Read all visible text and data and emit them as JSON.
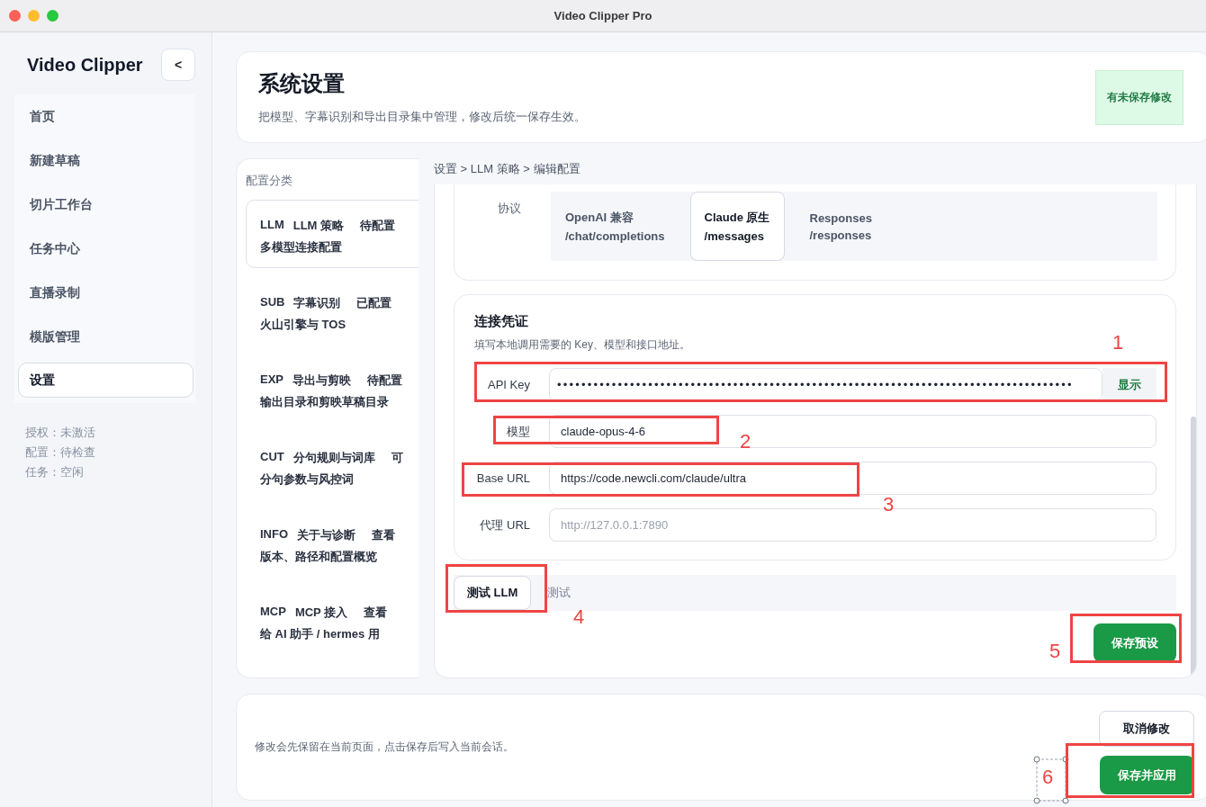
{
  "window": {
    "title": "Video Clipper Pro"
  },
  "sidebar": {
    "brand": "Video Clipper",
    "collapse_button": "<",
    "items": [
      {
        "label": "首页",
        "selected": false
      },
      {
        "label": "新建草稿",
        "selected": false
      },
      {
        "label": "切片工作台",
        "selected": false
      },
      {
        "label": "任务中心",
        "selected": false
      },
      {
        "label": "直播录制",
        "selected": false
      },
      {
        "label": "模版管理",
        "selected": false
      },
      {
        "label": "设置",
        "selected": true
      }
    ],
    "status": [
      "授权：未激活",
      "配置：待检查",
      "任务：空闲"
    ]
  },
  "header": {
    "title": "系统设置",
    "subtitle": "把模型、字幕识别和导出目录集中管理，修改后统一保存生效。",
    "badge": "有未保存修改"
  },
  "categories": {
    "title": "配置分类",
    "items": [
      {
        "code": "LLM",
        "name": "LLM 策略",
        "status": "待配置",
        "description": "多模型连接配置",
        "selected": true
      },
      {
        "code": "SUB",
        "name": "字幕识别",
        "status": "已配置",
        "description": "火山引擎与 TOS",
        "selected": false
      },
      {
        "code": "EXP",
        "name": "导出与剪映",
        "status": "待配置",
        "description": "输出目录和剪映草稿目录",
        "selected": false
      },
      {
        "code": "CUT",
        "name": "分句规则与词库",
        "status": "可",
        "description": "分句参数与风控词",
        "selected": false
      },
      {
        "code": "INFO",
        "name": "关于与诊断",
        "status": "查看",
        "description": "版本、路径和配置概览",
        "selected": false
      },
      {
        "code": "MCP",
        "name": "MCP 接入",
        "status": "查看",
        "description": "给 AI 助手 / hermes 用",
        "selected": false
      }
    ]
  },
  "breadcrumb": "设置 > LLM 策略 > 编辑配置",
  "protocol": {
    "label": "协议",
    "options": [
      {
        "name": "OpenAI 兼容",
        "path": "/chat/completions",
        "selected": false
      },
      {
        "name": "Claude 原生",
        "path": "/messages",
        "selected": true
      },
      {
        "name": "Responses",
        "path": "/responses",
        "selected": false
      }
    ]
  },
  "credentials": {
    "title": "连接凭证",
    "description": "填写本地调用需要的 Key、模型和接口地址。",
    "fields": [
      {
        "label": "API Key",
        "kind": "secret",
        "value": "•••••••••••••••••••••••••••••••••••••••••••••••••••••••••••••••••••••••••••••••••••••",
        "action": "显示"
      },
      {
        "label": "模型",
        "kind": "text",
        "value": "claude-opus-4-6"
      },
      {
        "label": "Base URL",
        "kind": "text",
        "value": "https://code.newcli.com/claude/ultra"
      },
      {
        "label": "代理 URL",
        "kind": "text",
        "placeholder": "http://127.0.0.1:7890"
      }
    ]
  },
  "test": {
    "button": "测试 LLM",
    "status": "测试"
  },
  "save_preset_button": "保存预设",
  "footer": {
    "note": "修改会先保留在当前页面，点击保存后写入当前会话。",
    "cancel_button": "取消修改",
    "apply_button": "保存并应用"
  },
  "annotations": [
    {
      "label": "1"
    },
    {
      "label": "2"
    },
    {
      "label": "3"
    },
    {
      "label": "4"
    },
    {
      "label": "5"
    },
    {
      "label": "6"
    }
  ]
}
